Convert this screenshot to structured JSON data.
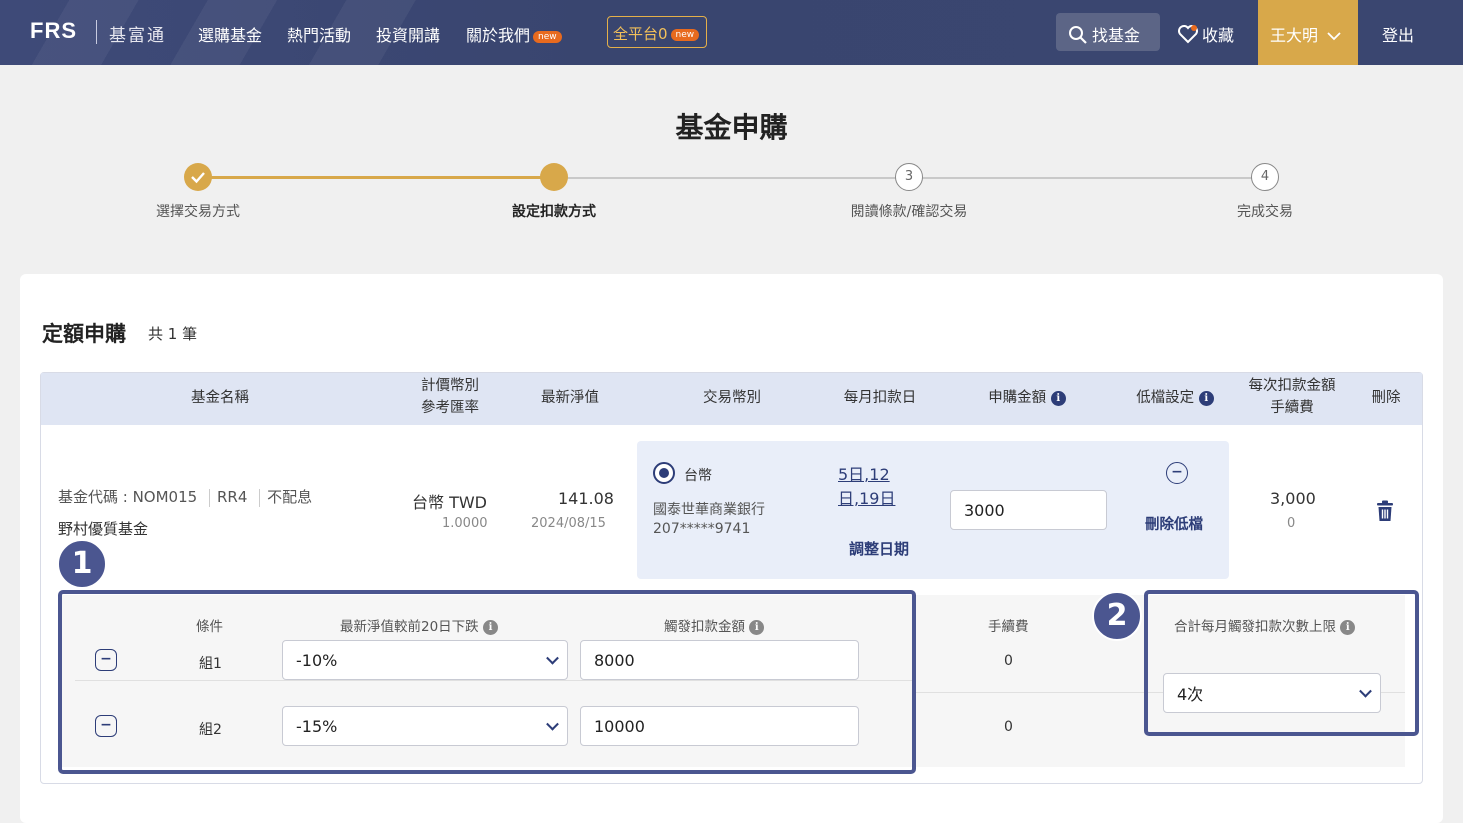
{
  "header": {
    "logo": "FRS",
    "brand_cn": "基富通",
    "nav": [
      {
        "label": "選購基金"
      },
      {
        "label": "熱門活動"
      },
      {
        "label": "投資開講"
      },
      {
        "label": "關於我們",
        "badge": "new"
      }
    ],
    "zero_fee": {
      "label": "全平台0",
      "badge": "new"
    },
    "search_label": "找基金",
    "favorites_label": "收藏",
    "user_name": "王大明",
    "logout_label": "登出"
  },
  "page_title": "基金申購",
  "stepper": {
    "steps": [
      {
        "label": "選擇交易方式",
        "state": "done"
      },
      {
        "label": "設定扣款方式",
        "state": "active"
      },
      {
        "label": "閱讀條款/確認交易",
        "state": "todo",
        "number": "3"
      },
      {
        "label": "完成交易",
        "state": "todo",
        "number": "4"
      }
    ]
  },
  "section": {
    "title": "定額申購",
    "count": "共 1 筆"
  },
  "table": {
    "headers": {
      "fund_name": "基金名稱",
      "currency_l1": "計價幣別",
      "currency_l2": "參考匯率",
      "nav": "最新淨值",
      "trade_currency": "交易幣別",
      "monthly_day": "每月扣款日",
      "amount": "申購金額",
      "low_setting": "低檔設定",
      "fee_l1": "每次扣款金額",
      "fee_l2": "手續費",
      "delete": "刪除"
    },
    "row": {
      "fund_code": "基金代碼 : NOM015",
      "risk": "RR4",
      "dividend": "不配息",
      "fund_name": "野村優質基金",
      "currency": "台幣 TWD",
      "rate": "1.0000",
      "nav": "141.08",
      "nav_date": "2024/08/15",
      "trade_currency": "台幣",
      "bank": "國泰世華商業銀行",
      "account": "207*****9741",
      "days_line1": "5日,12",
      "days_line2": "日,19日",
      "adjust_label": "調整日期",
      "amount": "3000",
      "delete_low_label": "刪除低檔",
      "deduct_amount": "3,000",
      "fee": "0"
    }
  },
  "low_conditions": {
    "headers": {
      "condition": "條件",
      "drop": "最新淨值較前20日下跌",
      "trigger": "觸發扣款金額",
      "fee": "手續費",
      "limit": "合計每月觸發扣款次數上限"
    },
    "rows": [
      {
        "group": "組1",
        "drop": "-10%",
        "trigger": "8000",
        "fee": "0"
      },
      {
        "group": "組2",
        "drop": "-15%",
        "trigger": "10000",
        "fee": "0"
      }
    ],
    "limit_value": "4次"
  },
  "annotations": {
    "badge1": "1",
    "badge2": "2"
  },
  "colors": {
    "header_bg": "#3e4a78",
    "accent_gold": "#d8a84a",
    "primary_navy": "#2d3d78",
    "highlight": "#4b5690",
    "new_badge": "#e86a1e"
  }
}
